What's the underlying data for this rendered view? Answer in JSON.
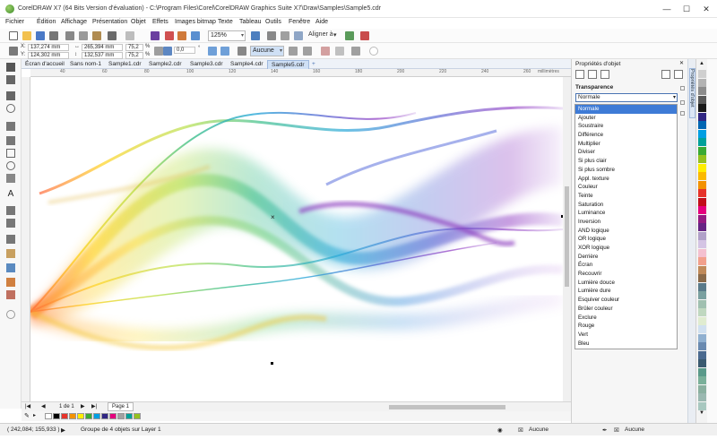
{
  "window": {
    "title": "CorelDRAW X7 (64 Bits Version d'évaluation) - C:\\Program Files\\Corel\\CorelDRAW Graphics Suite X7\\Draw\\Samples\\Sample5.cdr",
    "minimize_glyph": "—",
    "maximize_glyph": "☐",
    "close_glyph": "✕"
  },
  "menubar": {
    "items": [
      "Fichier",
      "Édition",
      "Affichage",
      "Présentation",
      "Objet",
      "Effets",
      "Images bitmap",
      "Texte",
      "Tableau",
      "Outils",
      "Fenêtre",
      "Aide"
    ]
  },
  "standard_toolbar": {
    "zoom": "125%",
    "snap_label": "Aligner à",
    "launch_arrow": "▾"
  },
  "property_bar": {
    "x_label": "X:",
    "x_value": "137,274 mm",
    "y_label": "Y:",
    "y_value": "124,302 mm",
    "w_value": "265,394 mm",
    "h_value": "132,537 mm",
    "scale_w": "75,2",
    "scale_h": "75,2",
    "pct": "%",
    "rotation": "0,0",
    "degree": "°",
    "outline_combo": "Aucune"
  },
  "document_tabs": [
    {
      "label": "Écran d'accueil",
      "active": false
    },
    {
      "label": "Sans nom-1",
      "active": false
    },
    {
      "label": "Sample1.cdr",
      "active": false
    },
    {
      "label": "Sample2.cdr",
      "active": false
    },
    {
      "label": "Sample3.cdr",
      "active": false
    },
    {
      "label": "Sample4.cdr",
      "active": false
    },
    {
      "label": "Sample5.cdr",
      "active": true
    }
  ],
  "ruler": {
    "h_ticks": [
      "40",
      "60",
      "80",
      "100",
      "120",
      "140",
      "160",
      "180",
      "200",
      "220",
      "240",
      "260"
    ],
    "unit": "millimètres"
  },
  "page_navigator": {
    "page_count": "1 de 1",
    "page_tab": "Page 1"
  },
  "docker": {
    "title": "Propriétés d'objet",
    "side_tab": "Propriétés d'objet",
    "section": "Transparence",
    "merge_mode": "Normale",
    "merge_modes": [
      "Normale",
      "Ajouter",
      "Soustraire",
      "Différence",
      "Multiplier",
      "Diviser",
      "Si plus clair",
      "Si plus sombre",
      "Appl. texture",
      "Couleur",
      "Teinte",
      "Saturation",
      "Luminance",
      "Inversion",
      "AND logique",
      "OR logique",
      "XOR logique",
      "Derrière",
      "Écran",
      "Recouvrir",
      "Lumière douce",
      "Lumière dure",
      "Esquiver couleur",
      "Brûler couleur",
      "Exclure",
      "Rouge",
      "Vert",
      "Bleu"
    ]
  },
  "status": {
    "coords": "( 242,084; 155,933 )",
    "selection_info": "Groupe de 4 objets sur Layer 1",
    "fill_label": "Aucune",
    "outline_label": "Aucune"
  },
  "colors": {
    "accent": "#3e7bd6",
    "palette_bottom": [
      "#ffffff",
      "#000000",
      "#e6332a",
      "#f39200",
      "#ffed00",
      "#3aaa35",
      "#009fe3",
      "#312783",
      "#e5007d",
      "#a1a1a1",
      "#00a19a",
      "#95c11f",
      "#ffffff"
    ],
    "palette_right": [
      "#cfcfcf",
      "#b3b3b3",
      "#8c8c8c",
      "#5a5a5a",
      "#1a1a1a",
      "#312783",
      "#0066b3",
      "#009fe3",
      "#00a19a",
      "#3aaa35",
      "#95c11f",
      "#ffed00",
      "#fbb900",
      "#f39200",
      "#e6332a",
      "#c20e1a",
      "#e5007d",
      "#951b81",
      "#662483",
      "#b0a0c8",
      "#d4c4e4",
      "#f4c0d0",
      "#f2a08c",
      "#c08a5a",
      "#8a6a4a",
      "#5a7a8a",
      "#7aa0a0",
      "#a0c0b0",
      "#c0d8c0",
      "#e0ecd0",
      "#d0e0f0",
      "#90b0d0",
      "#6a8ab0",
      "#4a6a90",
      "#3a5a70",
      "#5a9a8a",
      "#7ab09a",
      "#8ab0a0",
      "#9ab8b0",
      "#a8c8c0"
    ]
  }
}
